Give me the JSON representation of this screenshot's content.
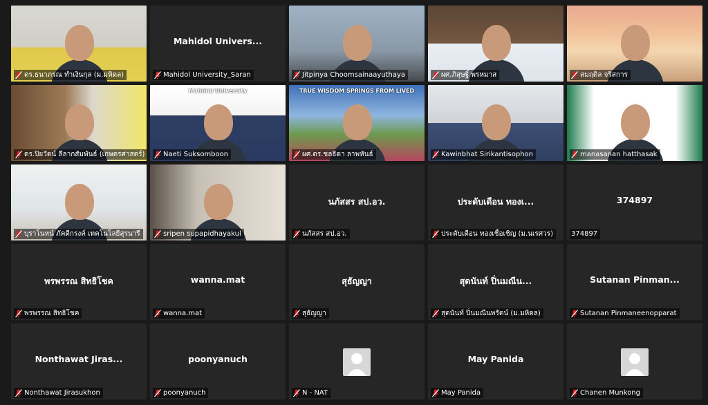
{
  "colors": {
    "tile_bg": "#262626",
    "active_border": "#d9d23a",
    "muted_mic": "#e02020"
  },
  "participants": [
    {
      "name": "ดร.ธนาภรณ ทำเงินกุล (ม.มหิดล)",
      "big": "",
      "video": true
    },
    {
      "name": "Mahidol University_Saran",
      "big": "Mahidol Univers...",
      "video": false
    },
    {
      "name": "Jitpinya Choomsainaayuthaya",
      "big": "",
      "video": true
    },
    {
      "name": "ผศ.ภิสุษฐิ์ พรหมาส",
      "big": "",
      "video": true
    },
    {
      "name": "สมฤดิล จริสการ",
      "big": "",
      "video": true
    },
    {
      "name": "ดร.ปิยวัตน์ ลีลากสัมพันธ์ (เกษตรศาสตร์)",
      "big": "",
      "video": true
    },
    {
      "name": "Naeti Suksomboon",
      "big": "",
      "video": true,
      "banner_text": "Mahidol University"
    },
    {
      "name": "ผศ.ดร.ชลธิดา ลาพหันธ์",
      "big": "",
      "video": true,
      "banner_text": "TRUE WISDOM SPRINGS FROM LIVED"
    },
    {
      "name": "Kawinbhat Sirikantisophon",
      "big": "",
      "video": true
    },
    {
      "name": "manasanan hatthasak",
      "big": "",
      "video": true,
      "active": true
    },
    {
      "name": "บุราโนหน์ ภัคดีกรงค์ เทคโนโลยีสุรนารี",
      "big": "",
      "video": true
    },
    {
      "name": "sripen supapidhayakul",
      "big": "",
      "video": true
    },
    {
      "name": "นภัสสร สป.อว.",
      "big": "นภัสสร สป.อว.",
      "video": false
    },
    {
      "name": "ประดับเดือน ทองเชื้อเชิญ (ม.นเรศวร)",
      "big": "ประดับเดือน ทองเ...",
      "video": false
    },
    {
      "name": "374897",
      "big": "374897",
      "video": false,
      "mic": false
    },
    {
      "name": "พรพรรณ สิทธิโชค",
      "big": "พรพรรณ สิทธิโชค",
      "video": false
    },
    {
      "name": "wanna.mat",
      "big": "wanna.mat",
      "video": false
    },
    {
      "name": "สุธัญญา",
      "big": "สุธัญญา",
      "video": false
    },
    {
      "name": "สุดนันท์ ปิ่นมณีนพรัตน์ (ม.มหิดล)",
      "big": "สุดนันท์ ปิ่นมณีน...",
      "video": false
    },
    {
      "name": "Sutanan Pinmaneenopparat",
      "big": "Sutanan Pinman...",
      "video": false
    },
    {
      "name": "Nonthawat Jirasukhon",
      "big": "Nonthawat Jiras...",
      "video": false
    },
    {
      "name": "poonyanuch",
      "big": "poonyanuch",
      "video": false
    },
    {
      "name": "N - NAT",
      "big": "",
      "video": false,
      "avatar": true
    },
    {
      "name": "May Panida",
      "big": "May Panida",
      "video": false
    },
    {
      "name": "Chanen Munkong",
      "big": "",
      "video": false,
      "avatar": true
    }
  ]
}
